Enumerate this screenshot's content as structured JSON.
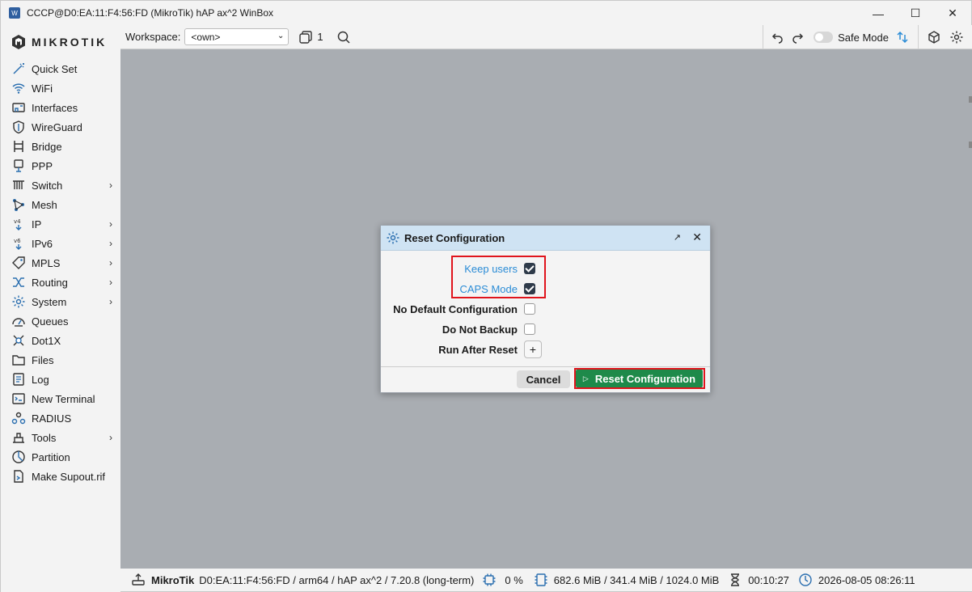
{
  "window": {
    "title": "CCCP@D0:EA:11:F4:56:FD (MikroTik) hAP ax^2 WinBox",
    "minimize": "—",
    "maximize": "☐",
    "close": "✕"
  },
  "brand": {
    "logo_text": "MIKROTIK"
  },
  "sidebar": {
    "items": [
      {
        "label": "Quick Set",
        "icon": "wand-icon",
        "has_submenu": false
      },
      {
        "label": "WiFi",
        "icon": "wifi-icon",
        "has_submenu": false
      },
      {
        "label": "Interfaces",
        "icon": "interfaces-icon",
        "has_submenu": false
      },
      {
        "label": "WireGuard",
        "icon": "shield-icon",
        "has_submenu": false
      },
      {
        "label": "Bridge",
        "icon": "bridge-icon",
        "has_submenu": false
      },
      {
        "label": "PPP",
        "icon": "ppp-icon",
        "has_submenu": false
      },
      {
        "label": "Switch",
        "icon": "switch-icon",
        "has_submenu": true
      },
      {
        "label": "Mesh",
        "icon": "mesh-icon",
        "has_submenu": false
      },
      {
        "label": "IP",
        "icon": "ipv4-icon",
        "has_submenu": true
      },
      {
        "label": "IPv6",
        "icon": "ipv6-icon",
        "has_submenu": true
      },
      {
        "label": "MPLS",
        "icon": "tag-icon",
        "has_submenu": true
      },
      {
        "label": "Routing",
        "icon": "routing-icon",
        "has_submenu": true
      },
      {
        "label": "System",
        "icon": "gear-icon",
        "has_submenu": true
      },
      {
        "label": "Queues",
        "icon": "gauge-icon",
        "has_submenu": false
      },
      {
        "label": "Dot1X",
        "icon": "dot1x-icon",
        "has_submenu": false
      },
      {
        "label": "Files",
        "icon": "folder-icon",
        "has_submenu": false
      },
      {
        "label": "Log",
        "icon": "log-icon",
        "has_submenu": false
      },
      {
        "label": "New Terminal",
        "icon": "terminal-icon",
        "has_submenu": false
      },
      {
        "label": "RADIUS",
        "icon": "radius-icon",
        "has_submenu": false
      },
      {
        "label": "Tools",
        "icon": "tools-icon",
        "has_submenu": true
      },
      {
        "label": "Partition",
        "icon": "partition-icon",
        "has_submenu": false
      },
      {
        "label": "Make Supout.rif",
        "icon": "supout-icon",
        "has_submenu": false
      }
    ]
  },
  "toolbar": {
    "workspace_label": "Workspace:",
    "workspace_value": "<own>",
    "window_count": "1",
    "safe_mode_label": "Safe Mode",
    "safe_mode_on": false
  },
  "dialog": {
    "title": "Reset Configuration",
    "fields": [
      {
        "label": "Keep users",
        "checked": true,
        "highlighted": true
      },
      {
        "label": "CAPS Mode",
        "checked": true,
        "highlighted": true
      },
      {
        "label": "No Default Configuration",
        "checked": false,
        "highlighted": false
      },
      {
        "label": "Do Not Backup",
        "checked": false,
        "highlighted": false
      }
    ],
    "run_after_reset_label": "Run After Reset",
    "add_symbol": "+",
    "cancel_label": "Cancel",
    "confirm_label": "Reset Configuration"
  },
  "status": {
    "device_name": "MikroTik",
    "device_info": "D0:EA:11:F4:56:FD / arm64 / hAP ax^2 / 7.20.8 (long-term)",
    "cpu": "0 %",
    "memory": "682.6 MiB / 341.4 MiB / 1024.0 MiB",
    "uptime": "00:10:27",
    "datetime": "2026-08-05 08:26:11"
  },
  "colors": {
    "accent_blue": "#2b8cd6",
    "confirm_green": "#1e8a4a",
    "highlight_red": "#e0141c",
    "workspace_bg": "#a9adb2"
  }
}
